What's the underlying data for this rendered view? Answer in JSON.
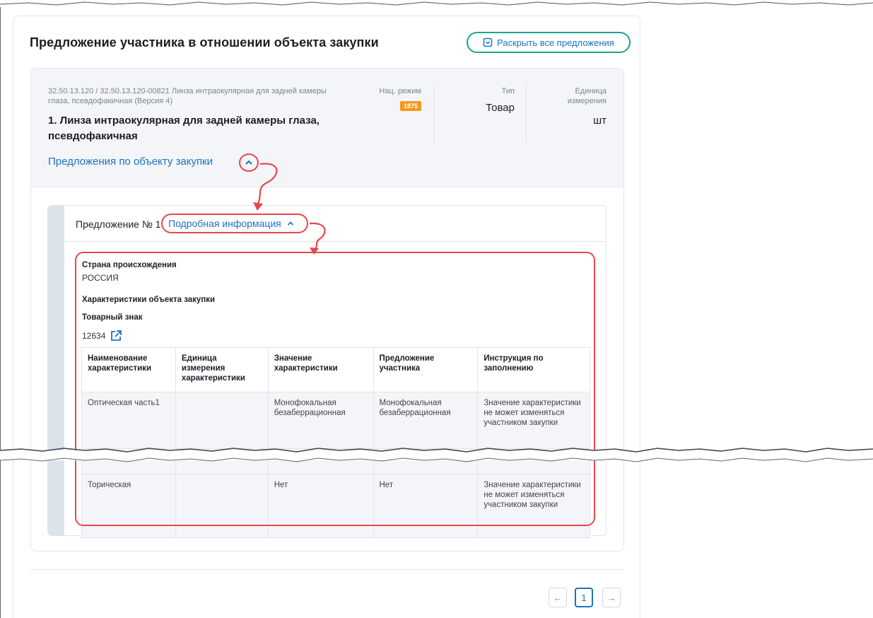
{
  "page": {
    "title": "Предложение участника в отношении объекта закупки",
    "expand_all_label": "Раскрыть все предложения"
  },
  "object": {
    "code": "32.50.13.120 / 32.50.13.120-00821 Линза интраокулярная для задней камеры глаза, псевдофакичная (Версия 4)",
    "name": "1. Линза интраокулярная для задней камеры глаза, псевдофакичная",
    "nat_mode_label": "Нац. режим",
    "nat_mode_badge": "1875",
    "type_label": "Тип",
    "type_value": "Товар",
    "unit_label": "Единица измерения",
    "unit_value": "шт",
    "offers_link": "Предложения по объекту закупки"
  },
  "proposal": {
    "label": "Предложение № 1",
    "details_link": "Подробная информация",
    "country_label": "Страна происхождения",
    "country_value": "РОССИЯ",
    "chars_label": "Характеристики объекта закупки",
    "trademark_label": "Товарный знак",
    "trademark_value": "12634"
  },
  "table": {
    "headers": [
      "Наименование характеристики",
      "Единица измерения характеристики",
      "Значение характеристики",
      "Предложение участника",
      "Инструкция по заполнению"
    ],
    "rows": [
      [
        "Оптическая часть1",
        "",
        "Монофокальная безаберрационная",
        "Монофокальная безаберрационная",
        "Значение характеристики не может изменяться участником закупки"
      ],
      [
        "Торическая",
        "",
        "Нет",
        "Нет",
        "Значение характеристики не может изменяться участником закупки"
      ]
    ]
  },
  "pagination": {
    "prev": "←",
    "current": "1",
    "next": "→"
  },
  "colors": {
    "accent": "#1a73c2",
    "highlight_red": "#e5484d",
    "highlight_green": "#1aa58c",
    "badge_orange": "#f39a1a"
  }
}
